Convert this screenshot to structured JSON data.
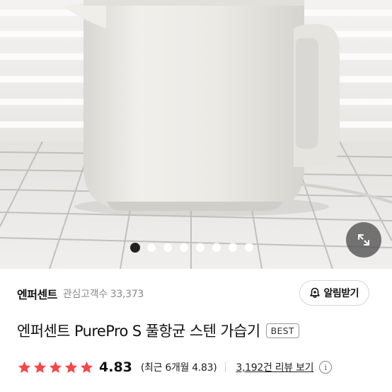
{
  "product_image": {
    "alt_icon": "kettle-photo",
    "dots_count": 8,
    "active_dot": 0,
    "zoom_icon": "expand-icon"
  },
  "brand": {
    "name": "엔퍼센트",
    "followers_label": "관심고객수",
    "followers_count": "33,373",
    "alarm_button": "알림받기",
    "alarm_icon": "bell-plus-icon"
  },
  "product": {
    "title": "엔퍼센트 PurePro S 풀항균 스텐 가습기",
    "badge": "BEST"
  },
  "rating": {
    "stars": 5,
    "score": "4.83",
    "recent": "(최근 6개월 4.83)",
    "reviews_link": "3,192건 리뷰 보기",
    "info_icon": "i"
  },
  "colors": {
    "star": "#f2474d",
    "active_dot": "#222222"
  }
}
